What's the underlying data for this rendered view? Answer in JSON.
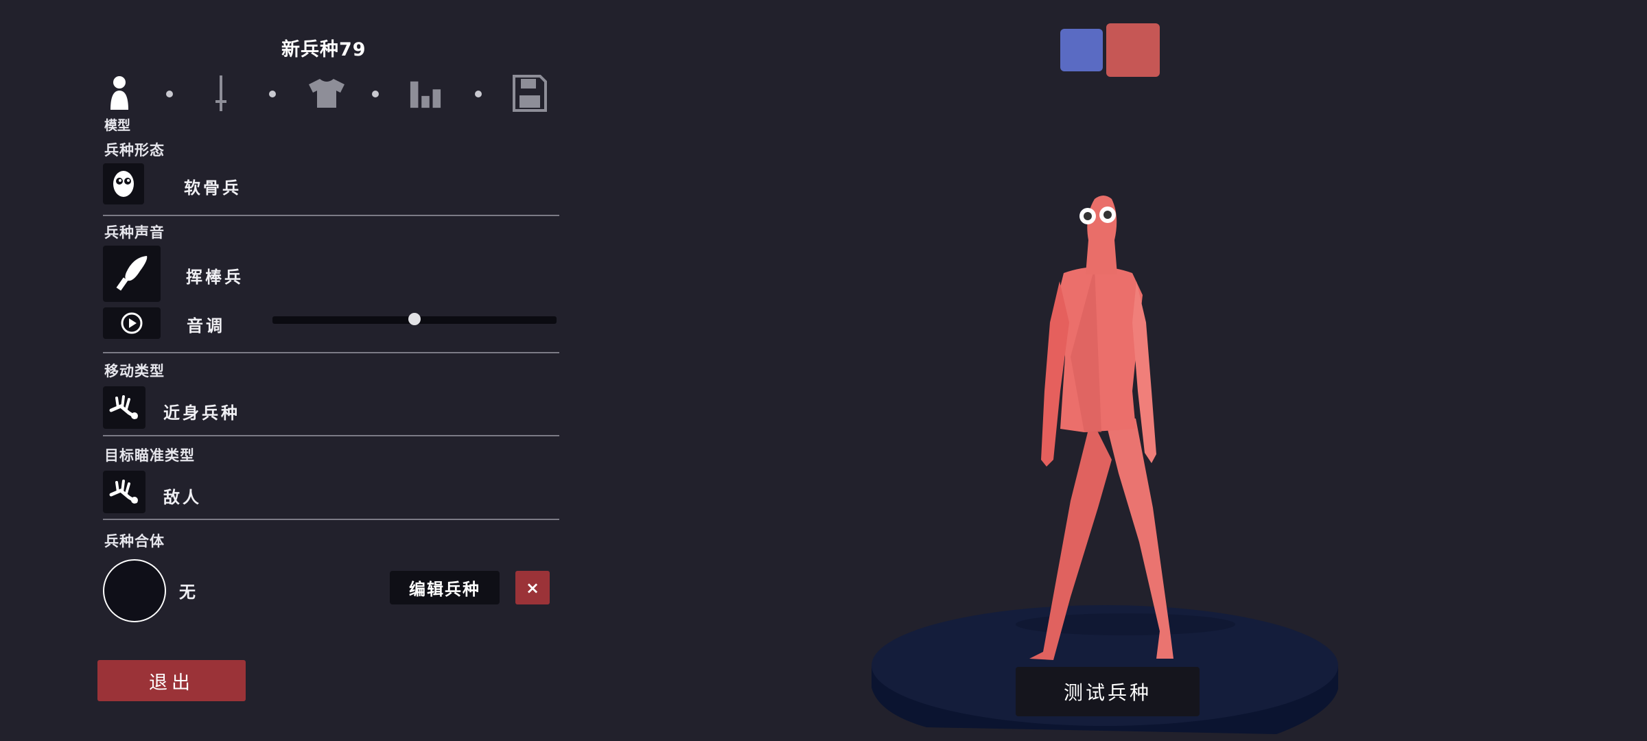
{
  "unit_name": "新兵种79",
  "tabs": [
    {
      "id": "model",
      "icon": "person-icon",
      "label": "模型"
    },
    {
      "id": "weapons",
      "icon": "sword-icon"
    },
    {
      "id": "clothing",
      "icon": "shirt-icon"
    },
    {
      "id": "stats",
      "icon": "bar-chart-icon"
    },
    {
      "id": "save",
      "icon": "save-icon"
    }
  ],
  "sections": {
    "form": {
      "label": "兵种形态",
      "value": "软骨兵",
      "icon": "googly-face-icon"
    },
    "voice": {
      "label": "兵种声音",
      "value": "挥棒兵",
      "icon": "drumstick-icon",
      "pitch_label": "音调",
      "pitch_value": 0.5,
      "play_icon": "play-circle-icon"
    },
    "movement": {
      "label": "移动类型",
      "value": "近身兵种",
      "icon": "melee-unit-icon"
    },
    "targeting": {
      "label": "目标瞄准类型",
      "value": "敌人",
      "icon": "target-enemy-icon"
    },
    "mount": {
      "label": "兵种合体",
      "value": "无",
      "edit_label": "编辑兵种",
      "close_label": "×"
    }
  },
  "exit_label": "退出",
  "test_label": "测试兵种",
  "team_colors": {
    "blue": "#5a6bc3",
    "red": "#c65755"
  },
  "colors": {
    "accent_red": "#9b3338",
    "background": "#22212c",
    "unit_skin": "#e86f6a"
  }
}
